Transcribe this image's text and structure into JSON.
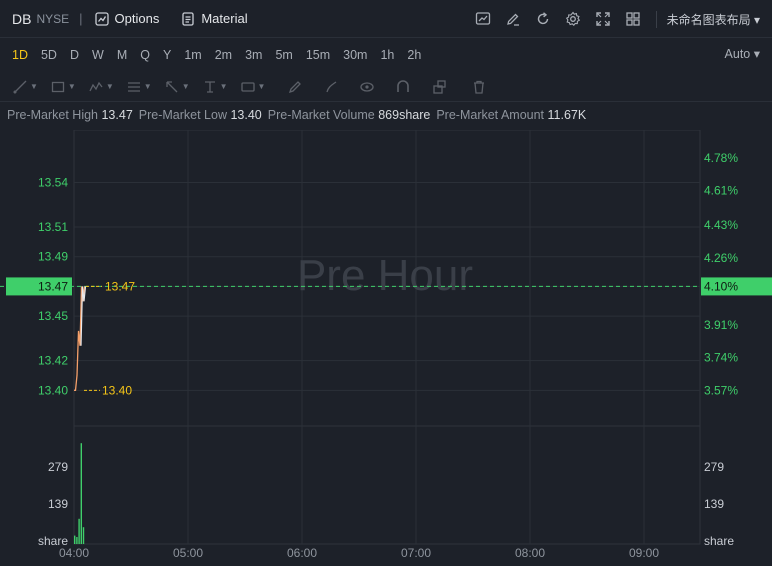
{
  "header": {
    "symbol": "DB",
    "exchange": "NYSE",
    "options_label": "Options",
    "material_label": "Material",
    "layout_name": "未命名图表布局 ▾"
  },
  "intervals": [
    "1D",
    "5D",
    "D",
    "W",
    "M",
    "Q",
    "Y",
    "1m",
    "2m",
    "3m",
    "5m",
    "15m",
    "30m",
    "1h",
    "2h"
  ],
  "active_interval": "1D",
  "scale_mode": "Auto ▾",
  "premarket": [
    {
      "label": "Pre-Market High",
      "value": "13.47"
    },
    {
      "label": "Pre-Market Low",
      "value": "13.40"
    },
    {
      "label": "Pre-Market Volume",
      "value": "869share"
    },
    {
      "label": "Pre-Market Amount",
      "value": "11.67K"
    }
  ],
  "chart_data": {
    "type": "line",
    "watermark": "Pre Hour",
    "x_ticks": [
      "04:00",
      "05:00",
      "06:00",
      "07:00",
      "08:00",
      "09:00"
    ],
    "price_ticks": [
      "13.54",
      "13.51",
      "13.49",
      "13.47",
      "13.45",
      "13.42",
      "13.40"
    ],
    "percent_ticks": [
      "4.78%",
      "4.61%",
      "4.43%",
      "4.26%",
      "4.10%",
      "3.91%",
      "3.74%",
      "3.57%"
    ],
    "current_price": "13.47",
    "current_percent": "4.10%",
    "high_label": "13.47",
    "low_label": "13.40",
    "ylim": [
      13.38,
      13.57
    ],
    "price_series": {
      "x": [
        "04:00",
        "04:01",
        "04:02",
        "04:03",
        "04:04",
        "04:05",
        "04:06",
        "04:07"
      ],
      "values": [
        13.4,
        13.4,
        13.41,
        13.44,
        13.43,
        13.47,
        13.46,
        13.47
      ]
    },
    "volume_ticks": [
      "279",
      "139",
      "share"
    ],
    "volume_series": {
      "x": [
        "04:00",
        "04:01",
        "04:02",
        "04:03",
        "04:04"
      ],
      "values": [
        30,
        25,
        90,
        360,
        60
      ]
    },
    "volume_ylim": [
      0,
      400
    ],
    "colors": {
      "up": "#3fcf6a",
      "price_line": "#e7e9ed",
      "accent_line": "#f5a06a",
      "label": "#f5c518"
    }
  }
}
